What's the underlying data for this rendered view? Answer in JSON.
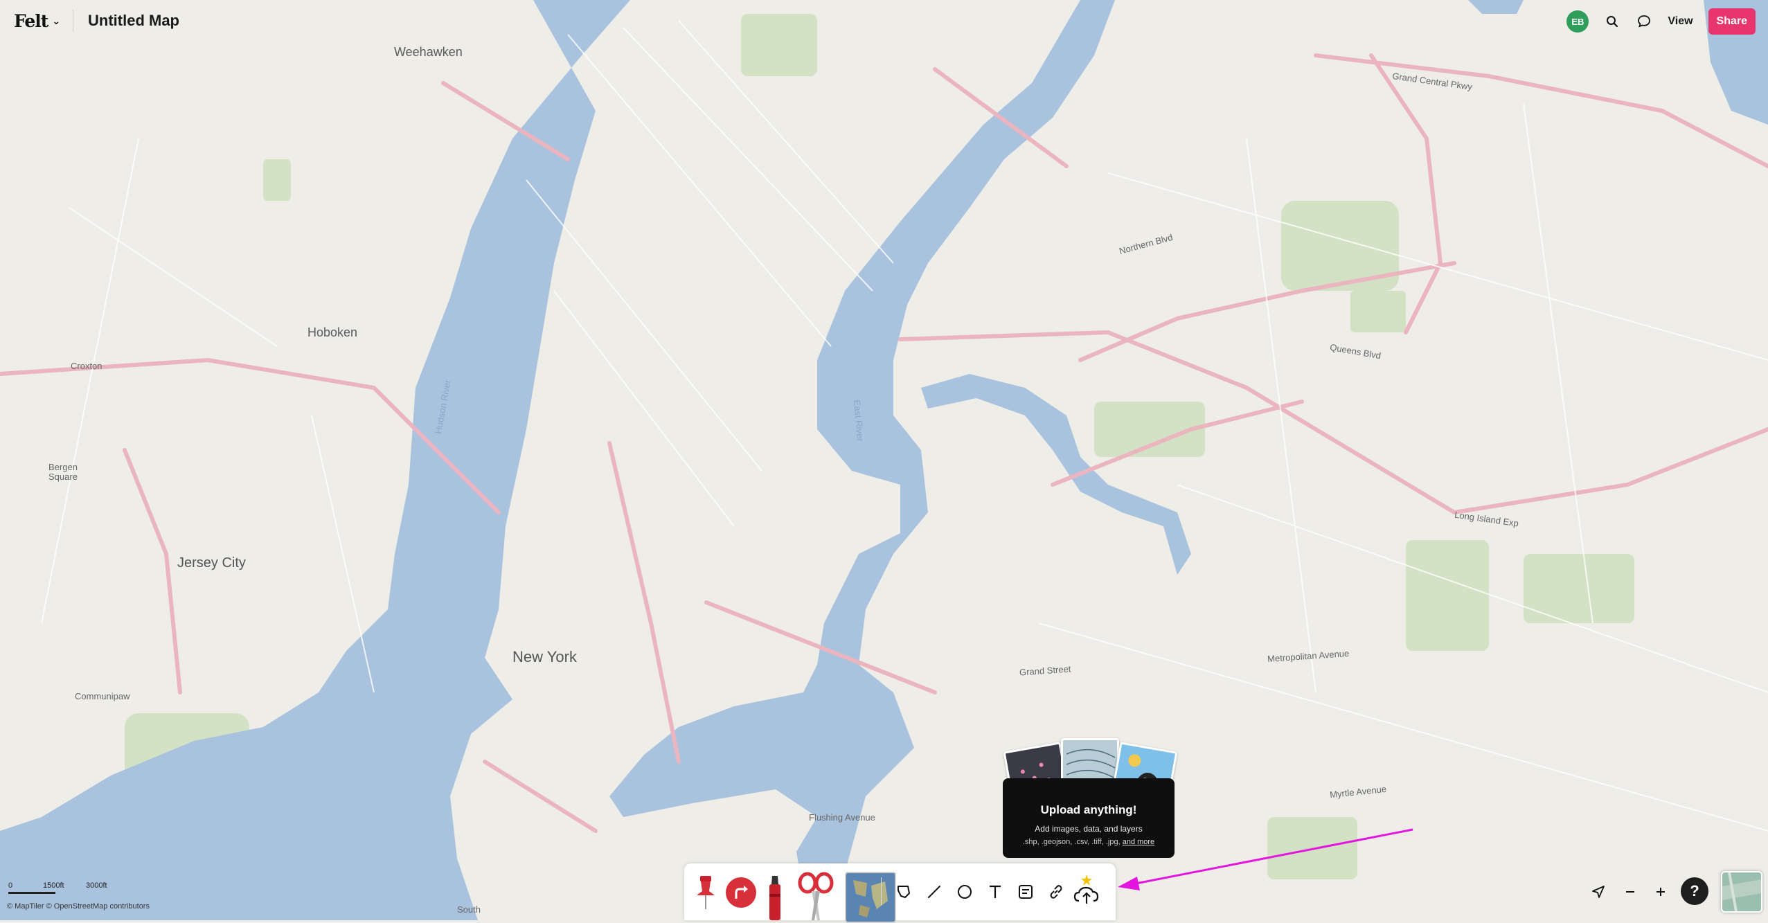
{
  "app": {
    "logo": "Felt",
    "map_title": "Untitled Map"
  },
  "header": {
    "avatar_initials": "EB",
    "view_label": "View",
    "share_label": "Share",
    "share_color": "#e9356e",
    "avatar_color": "#2f9e5a"
  },
  "map_labels": {
    "weehawken": "Weehawken",
    "hoboken": "Hoboken",
    "jersey_city": "Jersey City",
    "new_york": "New York",
    "croxton": "Croxton",
    "bergen_square": "Bergen\nSquare",
    "communipaw": "Communipaw",
    "hudson_river": "Hudson River",
    "east_river": "East River",
    "grand_central_pkwy": "Grand Central Pkwy",
    "queens_blvd": "Queens Blvd",
    "northern_blvd": "Northern Blvd",
    "myrtle_ave": "Myrtle Avenue",
    "flushing_ave": "Flushing Avenue",
    "grand_street": "Grand Street",
    "long_island_exp": "Long Island Exp",
    "metropolitan_ave": "Metropolitan Avenue",
    "south_label": "South"
  },
  "upload_popup": {
    "title": "Upload anything!",
    "subtitle": "Add images, data, and layers",
    "types": ".shp, .geojson, .csv, .tiff, .jpg,",
    "more_link": "and more"
  },
  "toolbar": {
    "tools": [
      "pin-tool",
      "route-tool",
      "marker-tool",
      "scissors-tool",
      "basemap-tool",
      "lasso-tool",
      "line-tool",
      "circle-tool",
      "text-tool",
      "note-tool",
      "link-tool",
      "upload-tool"
    ],
    "accent": "#d8303a"
  },
  "scale": {
    "zero": "0",
    "mid": "1500ft",
    "end": "3000ft"
  },
  "attribution": "© MapTiler  © OpenStreetMap contributors",
  "help_label": "?",
  "annotation": {
    "arrow_color": "#e515e0"
  }
}
